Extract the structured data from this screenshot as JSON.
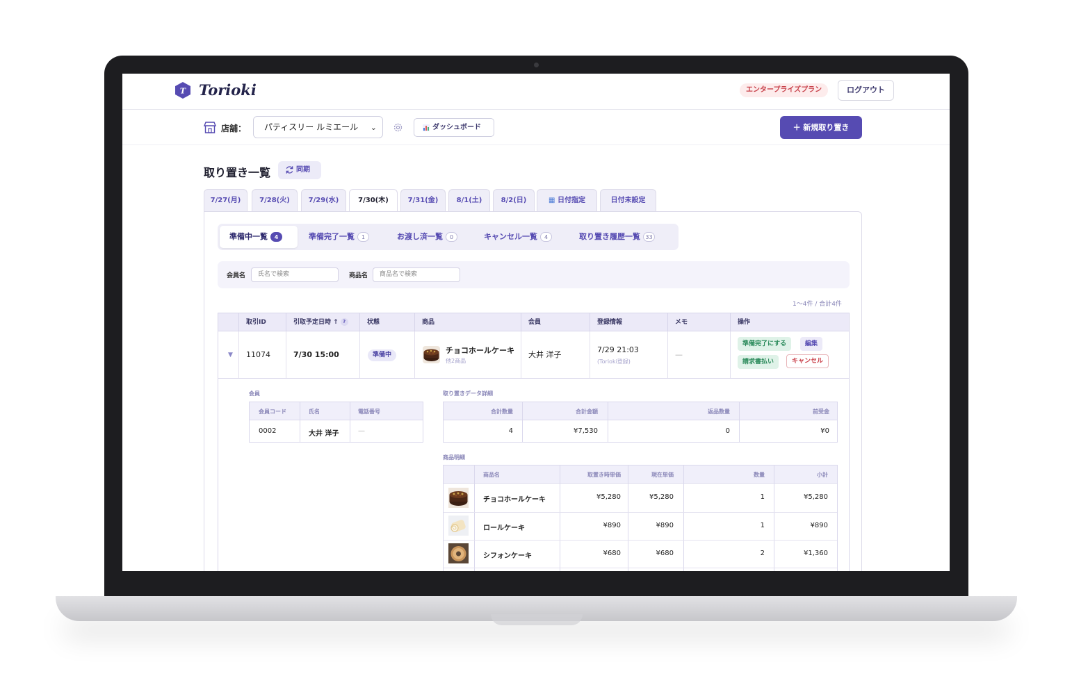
{
  "app": {
    "logo": "Torioki",
    "plan_badge": "エンタープライズプラン",
    "logout_label": "ログアウト"
  },
  "toolbar": {
    "store_label": "店舗：",
    "store_selected": "パティスリー ルミエール",
    "dashboard_label": "ダッシュボード",
    "new_label": "＋ 新規取り置き"
  },
  "page": {
    "title": "取り置き一覧",
    "sync_label": "同期"
  },
  "date_tabs": [
    "7/27(月)",
    "7/28(火)",
    "7/29(水)",
    "7/30(木)",
    "7/31(金)",
    "8/1(土)",
    "8/2(日)",
    "日付指定",
    "日付未設定"
  ],
  "status_tabs": [
    {
      "label": "準備中一覧",
      "count": "4"
    },
    {
      "label": "準備完了一覧",
      "count": "1"
    },
    {
      "label": "お渡し済一覧",
      "count": "0"
    },
    {
      "label": "キャンセル一覧",
      "count": "4"
    },
    {
      "label": "取り置き履歴一覧",
      "count": "33"
    }
  ],
  "filters": {
    "member_label": "会員名",
    "member_placeholder": "氏名で検索",
    "product_label": "商品名",
    "product_placeholder": "商品名で検索"
  },
  "paging": "1〜4件 / 合計4件",
  "table": {
    "headers": [
      "取引ID",
      "引取予定日時 ↑",
      "状態",
      "商品",
      "会員",
      "登録情報",
      "メモ",
      "操作"
    ],
    "help": "?",
    "row": {
      "id": "11074",
      "pickup": "7/30 15:00",
      "status": "準備中",
      "product": "チョコホールケーキ",
      "product_sub": "他2商品",
      "member": "大井 洋子",
      "registered": "7/29 21:03",
      "registered_sub": "(Torioki登録)",
      "memo": "—",
      "actions": {
        "ready": "準備完了にする",
        "edit": "編集",
        "invoice": "請求書払い",
        "cancel": "キャンセル"
      }
    }
  },
  "detail": {
    "member_section": "会員",
    "member_headers": [
      "会員コード",
      "氏名",
      "電話番号"
    ],
    "member_values": [
      "0002",
      "大井 洋子",
      "—"
    ],
    "summary_section": "取り置きデータ詳細",
    "summary_headers": [
      "合計数量",
      "合計金額",
      "返品数量",
      "前受金"
    ],
    "summary_values": [
      "4",
      "¥7,530",
      "0",
      "¥0"
    ],
    "items_section": "商品明細",
    "items_headers": [
      "商品名",
      "取置き時単価",
      "現在単価",
      "数量",
      "小計"
    ],
    "items": [
      {
        "name": "チョコホールケーキ",
        "unit_at_hold": "¥5,280",
        "unit_now": "¥5,280",
        "qty": "1",
        "subtotal": "¥5,280"
      },
      {
        "name": "ロールケーキ",
        "unit_at_hold": "¥890",
        "unit_now": "¥890",
        "qty": "1",
        "subtotal": "¥890"
      },
      {
        "name": "シフォンケーキ",
        "unit_at_hold": "¥680",
        "unit_now": "¥680",
        "qty": "2",
        "subtotal": "¥1,360"
      }
    ]
  },
  "colors": {
    "accent": "#564bb2",
    "badge_red": "#c8414a",
    "green": "#2a8a5a"
  }
}
